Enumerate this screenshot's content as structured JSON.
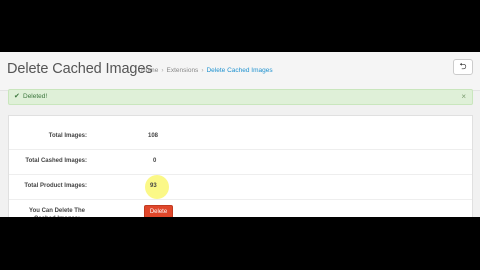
{
  "page": {
    "title": "Delete Cached Images",
    "breadcrumb": [
      "Home",
      "Extensions",
      "Delete Cached Images"
    ],
    "back_icon": "undo-arrow-icon"
  },
  "alert": {
    "icon": "check-circle-icon",
    "text": "Deleted!",
    "close": "×"
  },
  "stats": {
    "total_images_label": "Total Images:",
    "total_images_value": "108",
    "cached_label": "Total Cashed Images:",
    "cached_value": "0",
    "product_label": "Total Product Images:",
    "product_value": "93",
    "delete_label": "You Can Delete The Cached Images:",
    "delete_button": "Delete"
  },
  "colors": {
    "accent": "#1e91cf",
    "danger": "#e0472b",
    "success_bg": "#dff0d8",
    "highlight": "#fbf77a"
  }
}
